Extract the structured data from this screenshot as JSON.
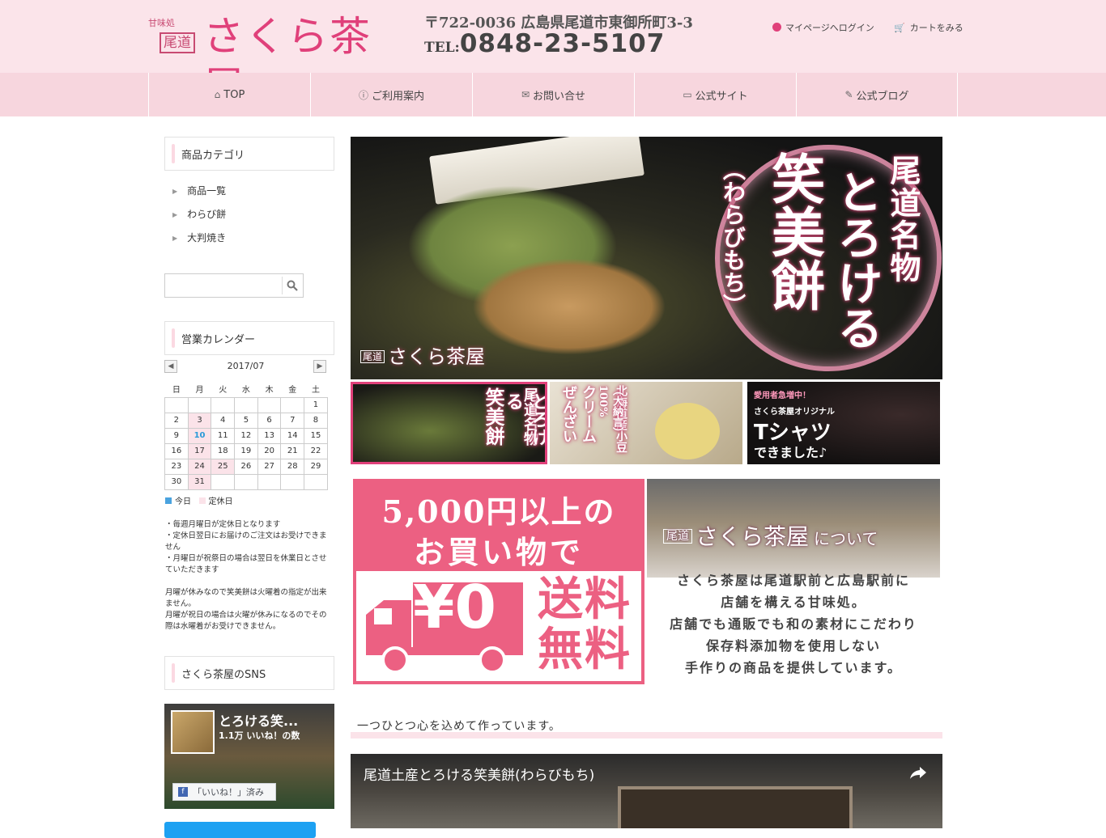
{
  "header": {
    "logo_small": "甘味処",
    "logo_box": "尾道",
    "logo_big": "さくら茶屋",
    "address": "〒722-0036 広島県尾道市東御所町3-3",
    "tel_label": "TEL:",
    "tel_number": "0848-23-5107",
    "login_label": "マイページへログイン",
    "cart_label": "カートをみる",
    "accent_color": "#e0407a"
  },
  "nav": [
    {
      "label": "TOP",
      "icon": "home-icon"
    },
    {
      "label": "ご利用案内",
      "icon": "info-icon"
    },
    {
      "label": "お問い合せ",
      "icon": "envelope-icon"
    },
    {
      "label": "公式サイト",
      "icon": "monitor-icon"
    },
    {
      "label": "公式ブログ",
      "icon": "edit-icon"
    }
  ],
  "sidebar": {
    "category_title": "商品カテゴリ",
    "categories": [
      "商品一覧",
      "わらび餅",
      "大判焼き"
    ],
    "search_placeholder": "",
    "calendar_title": "営業カレンダー",
    "calendar_month": "2017/07",
    "weekdays": [
      "日",
      "月",
      "火",
      "水",
      "木",
      "金",
      "土"
    ],
    "weeks": [
      [
        "",
        "",
        "",
        "",
        "",
        "",
        "1"
      ],
      [
        "2",
        "3",
        "4",
        "5",
        "6",
        "7",
        "8"
      ],
      [
        "9",
        "10",
        "11",
        "12",
        "13",
        "14",
        "15"
      ],
      [
        "16",
        "17",
        "18",
        "19",
        "20",
        "21",
        "22"
      ],
      [
        "23",
        "24",
        "25",
        "26",
        "27",
        "28",
        "29"
      ],
      [
        "30",
        "31",
        "",
        "",
        "",
        "",
        ""
      ]
    ],
    "holidays": [
      "3",
      "10",
      "17",
      "24",
      "25",
      "31"
    ],
    "today": "10",
    "legend_today": "今日",
    "legend_holiday": "定休日",
    "today_color": "#4aa3df",
    "holiday_color": "#fbe3e9",
    "notes": [
      "・毎週月曜日が定休日となります",
      "・定休日翌日にお届けのご注文はお受けできません",
      "・月曜日が祝祭日の場合は翌日を休業日とさせていただきます",
      "",
      "月曜が休みなので笑美餅は火曜着の指定が出来ません。",
      "月曜が祝日の場合は火曜が休みになるのでその際は水曜着がお受けできません。"
    ],
    "sns_title": "さくら茶屋のSNS",
    "fb_title": "とろける笑...",
    "fb_likes": "1.1万 いいね！の数",
    "fb_button": "「いいね！」済み"
  },
  "hero": {
    "small_logo_box": "尾道",
    "small_logo": "さくら茶屋",
    "col1": "尾道名物",
    "col2": "とろける",
    "col3": "笑美餅",
    "col4": "（わらびもち）"
  },
  "thumbs": {
    "t1_a": "尾道名物",
    "t1_b": "とろける",
    "t1_c": "笑美餅",
    "t2_a": "北海道産小豆",
    "t2_b": "（大納言）100%",
    "t2_c": "クリーム",
    "t2_d": "ぜんざい",
    "t3_a": "愛用者急増中！",
    "t3_b": "さくら茶屋オリジナル",
    "t3_c": "Tシャツ",
    "t3_d": "できました♪"
  },
  "shipping": {
    "line1": "5,000円以上の",
    "line2": "お買い物で",
    "yen": "¥0",
    "free": "送料無料"
  },
  "about": {
    "title_box": "尾道",
    "title": "さくら茶屋",
    "title_suffix": "について",
    "lines": [
      "さくら茶屋は尾道駅前と広島駅前に",
      "店舗を構える甘味処。",
      "店舗でも通販でも和の素材にこだわり",
      "保存料添加物を使用しない",
      "手作りの商品を提供しています。"
    ]
  },
  "section_heading": "一つひとつ心を込めて作っています。",
  "video": {
    "title": "尾道土産とろける笑美餅(わらびもち)"
  }
}
